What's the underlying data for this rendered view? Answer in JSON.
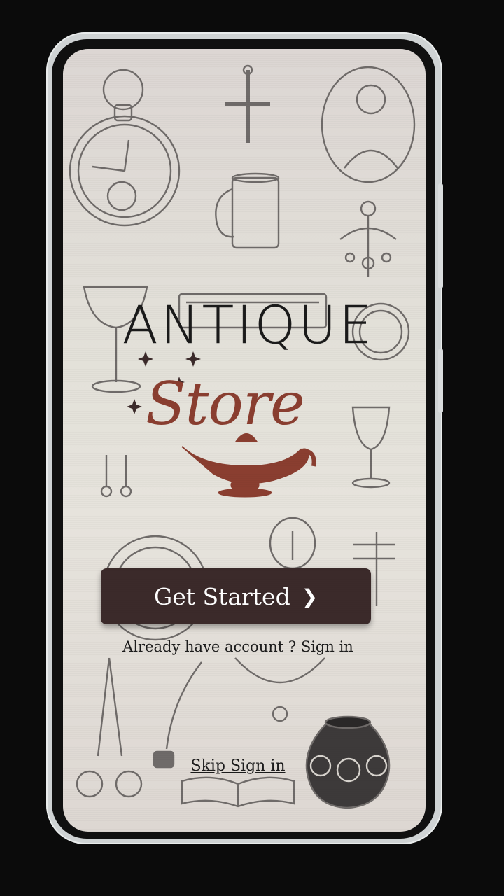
{
  "app": {
    "title": "ANTIQUE",
    "logo_word": "Store"
  },
  "actions": {
    "get_started_label": "Get Started",
    "get_started_icon": "chevron-right-icon",
    "signin_prompt": "Already have account ?",
    "signin_link": "Sign in",
    "skip_label": "Skip Sign in"
  },
  "colors": {
    "brand": "#8a3e30",
    "button_bg": "#3b2a2a",
    "button_text": "#ffffff",
    "text": "#1c1c1c"
  },
  "decorations": [
    "pocket-watch-icon",
    "cross-pendant-icon",
    "portrait-cameo-icon",
    "tankard-icon",
    "chandelier-earring-icon",
    "champagne-glass-icon",
    "vintage-box-icon",
    "medallion-icon",
    "goblet-icon",
    "drop-earrings-icon",
    "compass-icon",
    "chalice-cameo-icon",
    "key-icon",
    "scissors-icon",
    "quill-ink-icon",
    "necklace-icon",
    "open-book-icon",
    "vase-icon",
    "genie-lamp-icon"
  ]
}
